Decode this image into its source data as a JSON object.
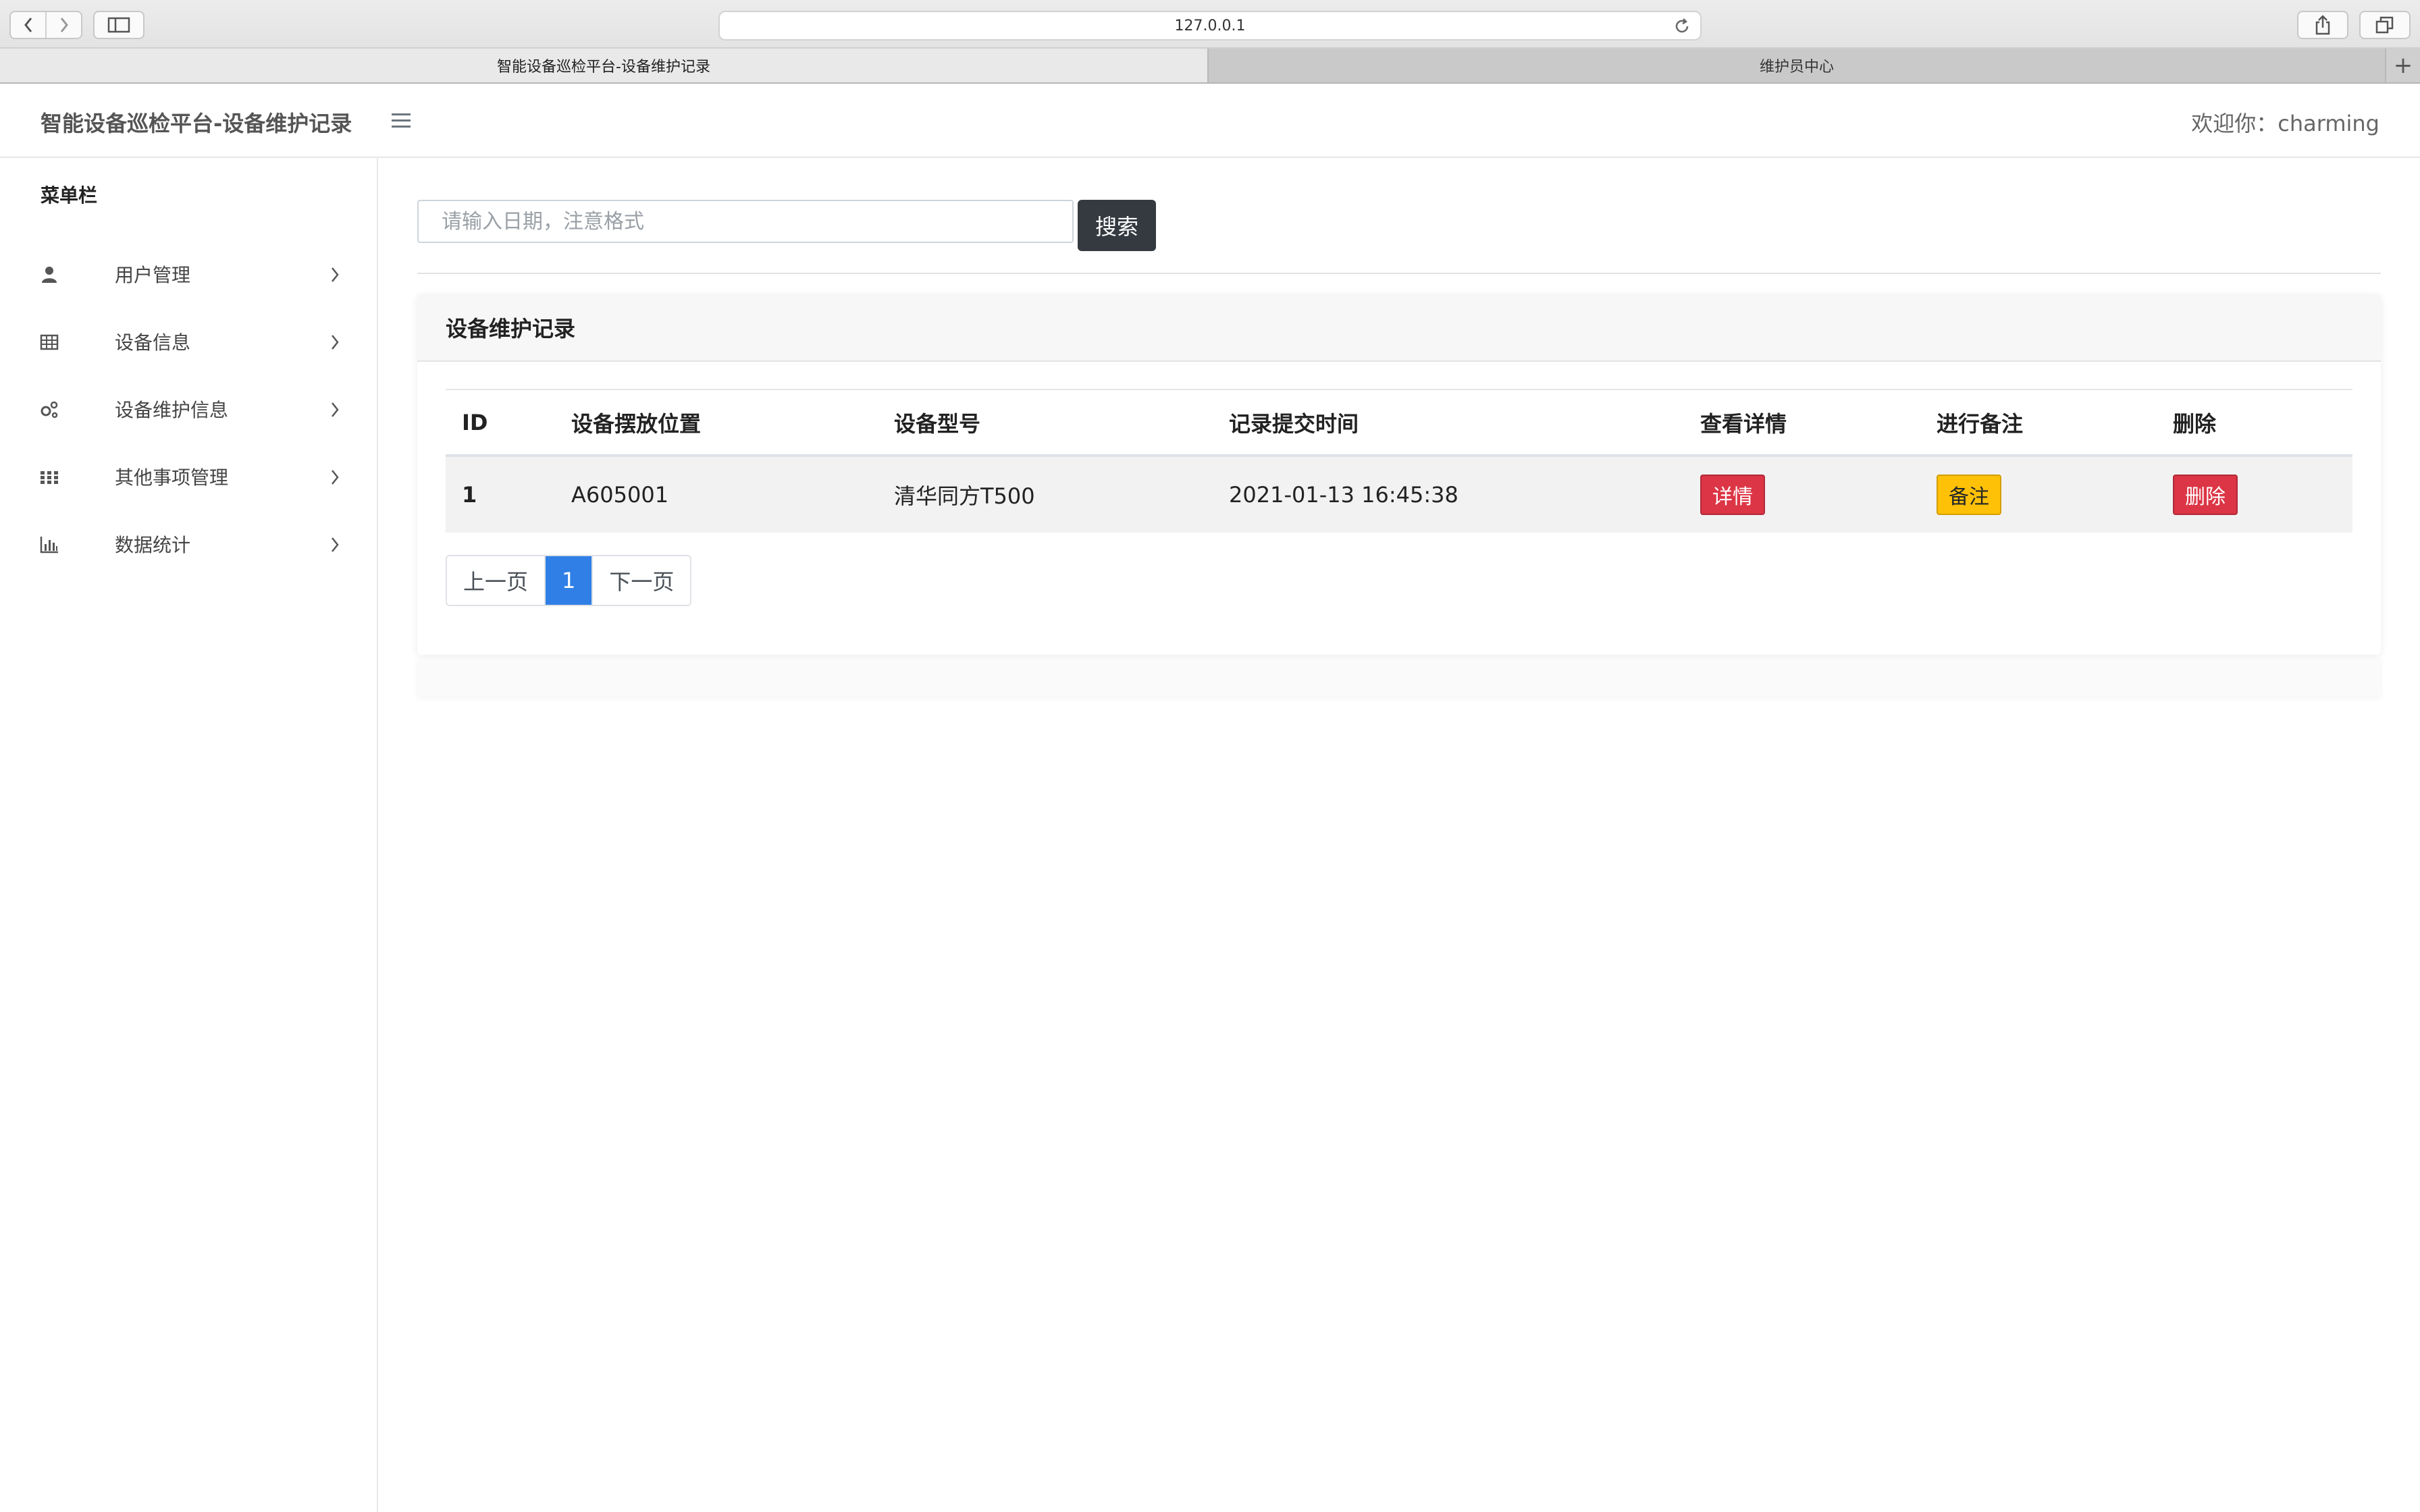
{
  "browser": {
    "url": "127.0.0.1",
    "tabs": [
      {
        "label": "智能设备巡检平台-设备维护记录",
        "active": true
      },
      {
        "label": "维护员中心",
        "active": false
      }
    ],
    "new_tab_label": "+"
  },
  "header": {
    "brand": "智能设备巡检平台-设备维护记录",
    "welcome": "欢迎你：charming"
  },
  "sidebar": {
    "title": "菜单栏",
    "items": [
      {
        "label": "用户管理",
        "icon": "user-icon"
      },
      {
        "label": "设备信息",
        "icon": "table-icon"
      },
      {
        "label": "设备维护信息",
        "icon": "gears-icon"
      },
      {
        "label": "其他事项管理",
        "icon": "grid-icon"
      },
      {
        "label": "数据统计",
        "icon": "bar-chart-icon"
      }
    ]
  },
  "search": {
    "placeholder": "请输入日期，注意格式",
    "value": "",
    "button_label": "搜索"
  },
  "card": {
    "title": "设备维护记录"
  },
  "table": {
    "headers": [
      "ID",
      "设备摆放位置",
      "设备型号",
      "记录提交时间",
      "查看详情",
      "进行备注",
      "删除"
    ],
    "rows": [
      {
        "id": "1",
        "location": "A605001",
        "model": "清华同方T500",
        "submitted_at": "2021-01-13 16:45:38",
        "detail_label": "详情",
        "note_label": "备注",
        "delete_label": "删除"
      }
    ]
  },
  "pagination": {
    "prev_label": "上一页",
    "current_page": "1",
    "next_label": "下一页"
  },
  "colors": {
    "primary": "#2f7fe6",
    "danger": "#dc3545",
    "warning": "#ffc107",
    "dark": "#343a40"
  }
}
